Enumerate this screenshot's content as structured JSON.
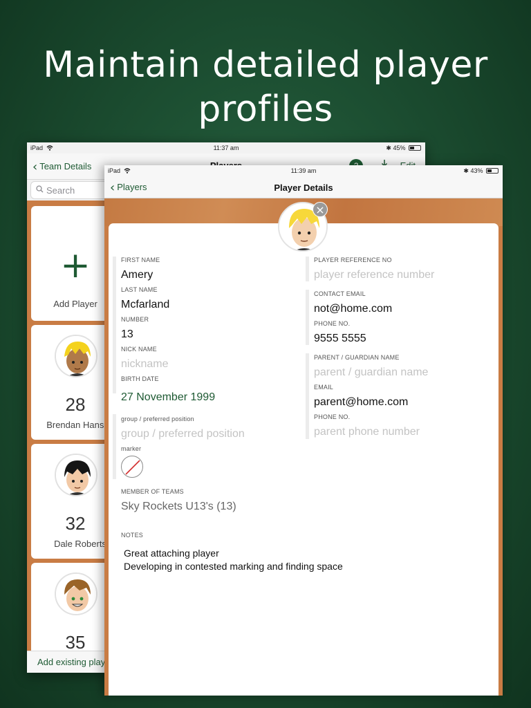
{
  "headline": "Maintain detailed player profiles",
  "back_screen": {
    "status": {
      "device": "iPad",
      "time": "11:37 am",
      "battery": "45%",
      "battery_level": 0.45
    },
    "nav": {
      "back_label": "Team Details",
      "title": "Players",
      "help_label": "?",
      "edit_label": "Edit"
    },
    "search": {
      "placeholder": "Search"
    },
    "add_card": {
      "label": "Add Player"
    },
    "players": [
      {
        "number": "28",
        "name": "Brendan Hansen"
      },
      {
        "number": "32",
        "name": "Dale Roberts"
      },
      {
        "number": "35",
        "name": ""
      }
    ],
    "bottom_label": "Add existing player"
  },
  "front_screen": {
    "status": {
      "device": "iPad",
      "time": "11:39 am",
      "battery": "43%",
      "battery_level": 0.43
    },
    "nav": {
      "back_label": "Players",
      "title": "Player Details"
    },
    "fields": {
      "first_name_label": "FIRST NAME",
      "first_name": "Amery",
      "last_name_label": "LAST NAME",
      "last_name": "Mcfarland",
      "number_label": "NUMBER",
      "number": "13",
      "nick_name_label": "NICK NAME",
      "nick_name_placeholder": "nickname",
      "birth_date_label": "BIRTH DATE",
      "birth_date": "27 November 1999",
      "position_label": "group / preferred position",
      "position_placeholder": "group / preferred position",
      "marker_label": "marker",
      "ref_label": "PLAYER REFERENCE NO",
      "ref_placeholder": "player reference number",
      "contact_email_label": "CONTACT EMAIL",
      "contact_email": "not@home.com",
      "phone_label": "PHONE NO.",
      "phone": "9555 5555",
      "guardian_label": "PARENT / GUARDIAN NAME",
      "guardian_placeholder": "parent / guardian name",
      "guardian_email_label": "EMAIL",
      "guardian_email": "parent@home.com",
      "guardian_phone_label": "PHONE NO.",
      "guardian_phone_placeholder": "parent phone number",
      "teams_label": "MEMBER OF TEAMS",
      "teams": "Sky Rockets U13's (13)",
      "notes_label": "NOTES",
      "notes": "Great attaching player\nDeveloping in contested marking and finding space"
    }
  },
  "colors": {
    "accent": "#1e5a33",
    "wood": "#c97c44",
    "background": "#1e5234"
  },
  "icons": [
    "wifi-icon",
    "bluetooth-icon",
    "battery-icon",
    "chevron-left-icon",
    "search-icon",
    "help-icon",
    "export-icon",
    "plus-icon",
    "close-icon",
    "avatar-icon"
  ]
}
